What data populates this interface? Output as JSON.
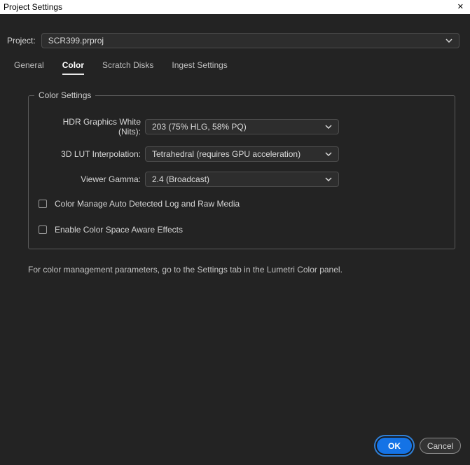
{
  "window": {
    "title": "Project Settings",
    "close_glyph": "✕"
  },
  "project": {
    "label": "Project:",
    "value": "SCR399.prproj"
  },
  "tabs": [
    {
      "label": "General",
      "active": false
    },
    {
      "label": "Color",
      "active": true
    },
    {
      "label": "Scratch Disks",
      "active": false
    },
    {
      "label": "Ingest Settings",
      "active": false
    }
  ],
  "color_settings": {
    "group_title": "Color Settings",
    "fields": [
      {
        "label": "HDR Graphics White (Nits):",
        "value": "203 (75% HLG, 58% PQ)"
      },
      {
        "label": "3D LUT Interpolation:",
        "value": "Tetrahedral (requires GPU acceleration)"
      },
      {
        "label": "Viewer Gamma:",
        "value": "2.4 (Broadcast)"
      }
    ],
    "checkboxes": [
      {
        "label": "Color Manage Auto Detected Log and Raw Media",
        "checked": false
      },
      {
        "label": "Enable Color Space Aware Effects",
        "checked": false
      }
    ]
  },
  "footer_note": "For color management parameters, go to the Settings tab in the Lumetri Color panel.",
  "buttons": {
    "ok": "OK",
    "cancel": "Cancel"
  },
  "colors": {
    "accent_blue": "#1473e6",
    "dialog_bg": "#232323",
    "titlebar_bg": "#ffffff"
  }
}
